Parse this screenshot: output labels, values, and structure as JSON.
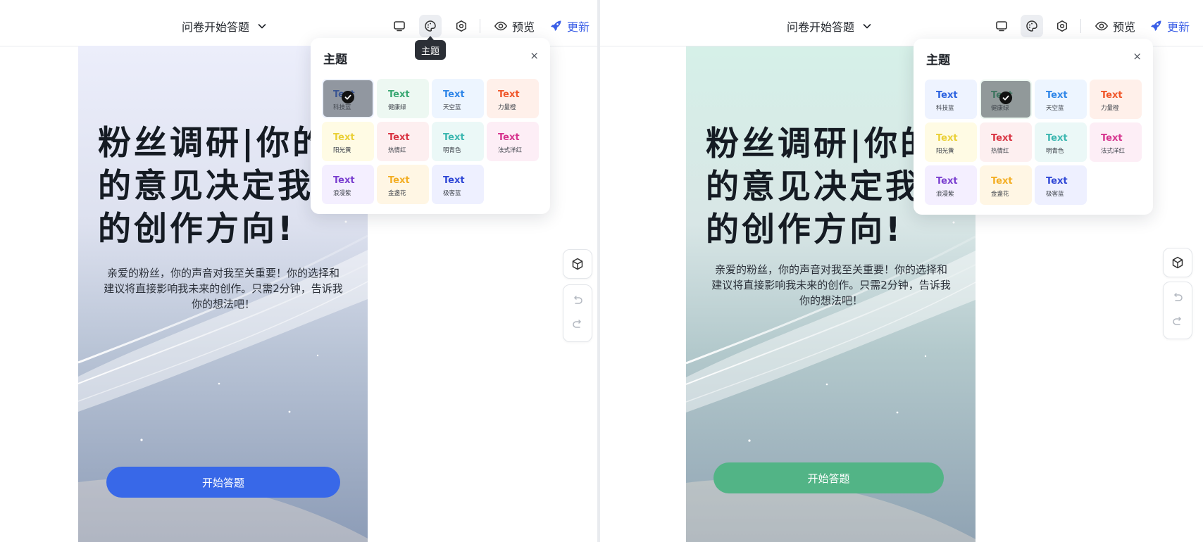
{
  "toolbar": {
    "page_select_label": "问卷开始答题",
    "preview_label": "预览",
    "update_label": "更新",
    "tooltip_theme": "主题"
  },
  "canvas": {
    "title": "粉丝调研|你的\n的意见决定我\n的创作方向!",
    "description": "亲爱的粉丝，你的声音对我至关重要！你的选择和建议将直接影响我未来的创作。只需2分钟，告诉我你的想法吧！",
    "start_button": "开始答题"
  },
  "theme_popup": {
    "title": "主题",
    "close": "×",
    "sample_text": "Text",
    "themes": [
      {
        "name": "科技蓝",
        "color": "#2d63e0",
        "bg": "#eef3ff"
      },
      {
        "name": "健康绿",
        "color": "#3aa873",
        "bg": "#edf8f2"
      },
      {
        "name": "天空蓝",
        "color": "#2f86e8",
        "bg": "#edf5ff"
      },
      {
        "name": "力量橙",
        "color": "#f0562a",
        "bg": "#fff0ea"
      },
      {
        "name": "阳光黄",
        "color": "#ead038",
        "bg": "#fffbe4"
      },
      {
        "name": "热情红",
        "color": "#d93443",
        "bg": "#fdeff0"
      },
      {
        "name": "明青色",
        "color": "#3cb7b0",
        "bg": "#ebf8f7"
      },
      {
        "name": "法式洋红",
        "color": "#d6348e",
        "bg": "#fdeef6"
      },
      {
        "name": "浪漫紫",
        "color": "#7a3fd0",
        "bg": "#f4efff"
      },
      {
        "name": "金盏花",
        "color": "#f3ae24",
        "bg": "#fff6e4"
      },
      {
        "name": "极客蓝",
        "color": "#2f47d6",
        "bg": "#eef0ff"
      }
    ]
  },
  "views": [
    {
      "selected_theme": "科技蓝",
      "button_color": "#3868e8"
    },
    {
      "selected_theme": "健康绿",
      "button_color": "#52b486"
    }
  ],
  "colors": {
    "accent": "#3a5ee6",
    "toolbar_border": "#e8eaee"
  },
  "icons": [
    "monitor-icon",
    "palette-icon",
    "settings-icon",
    "eye-icon",
    "rocket-icon",
    "chevron-down-icon",
    "cube-icon",
    "undo-icon",
    "redo-icon",
    "check-icon",
    "close-icon"
  ]
}
